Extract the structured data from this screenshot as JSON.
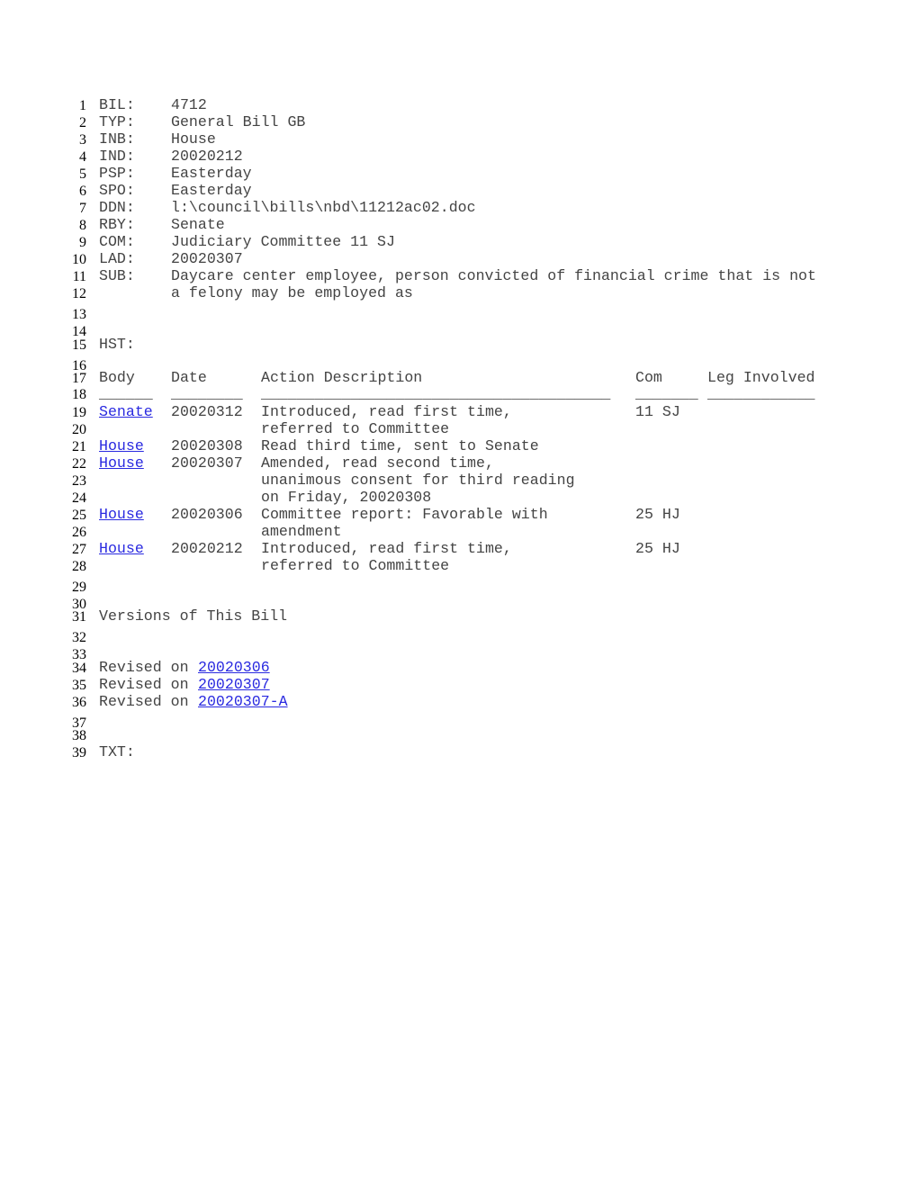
{
  "line_numbers": [
    "1",
    "2",
    "3",
    "4",
    "5",
    "6",
    "7",
    "8",
    "9",
    "10",
    "11",
    "12",
    "13",
    "14",
    "15",
    "16",
    "17",
    "18",
    "19",
    "20",
    "21",
    "22",
    "23",
    "24",
    "25",
    "26",
    "27",
    "28",
    "29",
    "30",
    "31",
    "32",
    "33",
    "34",
    "35",
    "36",
    "37",
    "38",
    "39"
  ],
  "header_fields": [
    {
      "key": "BIL:",
      "value": "4712"
    },
    {
      "key": "TYP:",
      "value": "General Bill GB"
    },
    {
      "key": "INB:",
      "value": "House"
    },
    {
      "key": "IND:",
      "value": "20020212"
    },
    {
      "key": "PSP:",
      "value": "Easterday"
    },
    {
      "key": "SPO:",
      "value": "Easterday"
    },
    {
      "key": "DDN:",
      "value": "l:\\council\\bills\\nbd\\11212ac02.doc"
    },
    {
      "key": "RBY:",
      "value": "Senate"
    },
    {
      "key": "COM:",
      "value": "Judiciary Committee 11 SJ"
    },
    {
      "key": "LAD:",
      "value": "20020307"
    },
    {
      "key": "SUB:",
      "value": "Daycare center employee, person convicted of financial crime that is not"
    },
    {
      "key": "",
      "value": "a felony may be employed as"
    }
  ],
  "history": {
    "label": "HST:",
    "columns": {
      "body": "Body",
      "date": "Date",
      "action": "Action Description",
      "com": "Com",
      "leg": "Leg Involved"
    },
    "rules": {
      "body": "______",
      "date": "________",
      "action": "_______________________________________",
      "com": "_______",
      "leg": "____________"
    },
    "rows": [
      {
        "body": "Senate",
        "date": "20020312",
        "action": [
          "Introduced, read first time,",
          "referred to Committee"
        ],
        "com": "11 SJ",
        "leg": ""
      },
      {
        "body": "House",
        "date": "20020308",
        "action": [
          "Read third time, sent to Senate"
        ],
        "com": "",
        "leg": ""
      },
      {
        "body": "House",
        "date": "20020307",
        "action": [
          "Amended, read second time,",
          "unanimous consent for third reading",
          "on Friday, 20020308"
        ],
        "com": "",
        "leg": ""
      },
      {
        "body": "House",
        "date": "20020306",
        "action": [
          "Committee report: Favorable with",
          "amendment"
        ],
        "com": "25 HJ",
        "leg": ""
      },
      {
        "body": "House",
        "date": "20020212",
        "action": [
          "Introduced, read first time,",
          "referred to Committee"
        ],
        "com": "25 HJ",
        "leg": ""
      }
    ]
  },
  "versions": {
    "title": "Versions of This Bill",
    "prefix": "Revised on",
    "items": [
      "20020306",
      "20020307",
      "20020307-A"
    ]
  },
  "text_label": "TXT:",
  "colors": {
    "link": "#2a2ae0",
    "text": "#444444"
  }
}
